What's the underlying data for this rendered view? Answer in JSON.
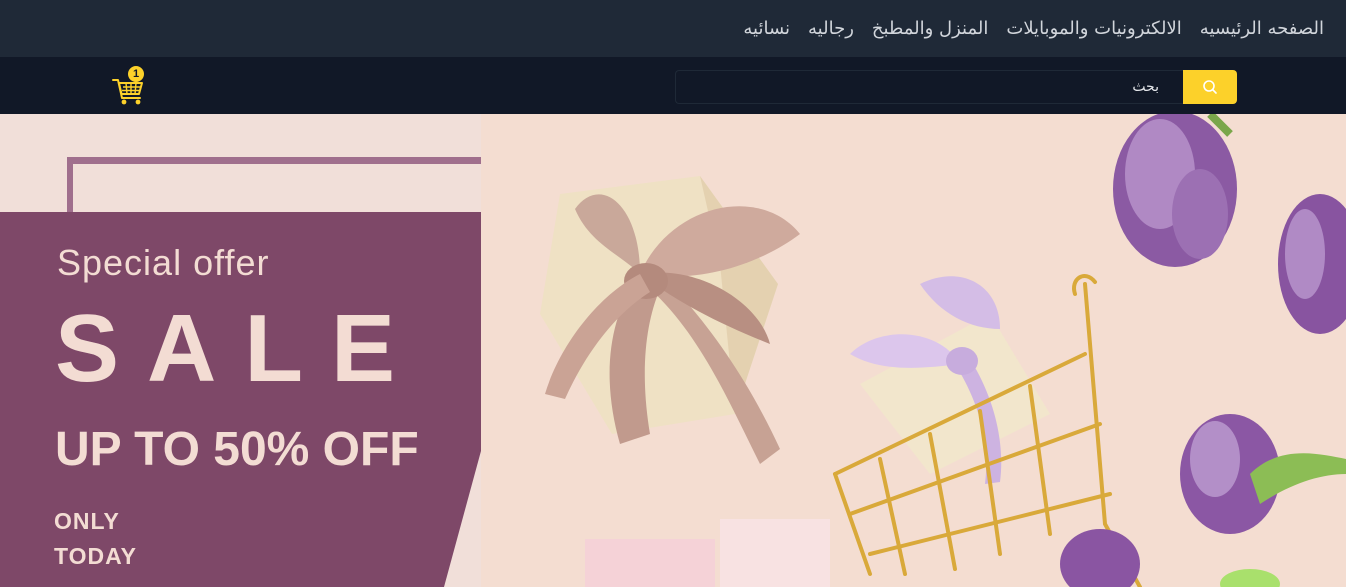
{
  "nav": {
    "items": [
      {
        "label": "الصفحه الرئيسيه"
      },
      {
        "label": "الالكترونيات والموبايلات"
      },
      {
        "label": "المنزل والمطبخ"
      },
      {
        "label": "رجاليه"
      },
      {
        "label": "نسائيه"
      }
    ]
  },
  "search": {
    "placeholder": "بحث",
    "button_icon": "search-icon"
  },
  "cart": {
    "icon": "cart-icon",
    "count": "1"
  },
  "banner": {
    "special": "Special offer",
    "sale": "SALE",
    "discount": "UP TO 50% OFF",
    "only": "ONLY",
    "today": "TODAY"
  },
  "colors": {
    "nav_bg": "#1f2937",
    "search_bg": "#111827",
    "accent": "#fcd12a",
    "promo_purple": "#7e4868"
  }
}
